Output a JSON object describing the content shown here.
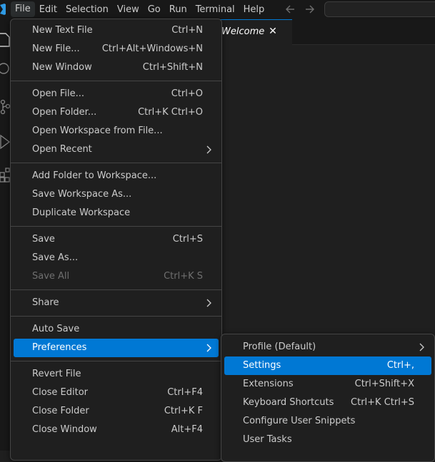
{
  "menubar": {
    "items": [
      "File",
      "Edit",
      "Selection",
      "View",
      "Go",
      "Run",
      "Terminal",
      "Help"
    ]
  },
  "nav": {
    "back_icon": "arrow-left-icon",
    "forward_icon": "arrow-right-icon"
  },
  "editor": {
    "tab": {
      "label": "Welcome",
      "close": "✕"
    }
  },
  "file_menu": {
    "groups": [
      [
        {
          "label": "New Text File",
          "shortcut": "Ctrl+N"
        },
        {
          "label": "New File...",
          "shortcut": "Ctrl+Alt+Windows+N"
        },
        {
          "label": "New Window",
          "shortcut": "Ctrl+Shift+N"
        }
      ],
      [
        {
          "label": "Open File...",
          "shortcut": "Ctrl+O"
        },
        {
          "label": "Open Folder...",
          "shortcut": "Ctrl+K Ctrl+O"
        },
        {
          "label": "Open Workspace from File...",
          "shortcut": ""
        },
        {
          "label": "Open Recent",
          "shortcut": "",
          "submenu": true
        }
      ],
      [
        {
          "label": "Add Folder to Workspace...",
          "shortcut": ""
        },
        {
          "label": "Save Workspace As...",
          "shortcut": ""
        },
        {
          "label": "Duplicate Workspace",
          "shortcut": ""
        }
      ],
      [
        {
          "label": "Save",
          "shortcut": "Ctrl+S"
        },
        {
          "label": "Save As...",
          "shortcut": ""
        },
        {
          "label": "Save All",
          "shortcut": "Ctrl+K S",
          "disabled": true
        }
      ],
      [
        {
          "label": "Share",
          "shortcut": "",
          "submenu": true
        }
      ],
      [
        {
          "label": "Auto Save",
          "shortcut": ""
        },
        {
          "label": "Preferences",
          "shortcut": "",
          "submenu": true,
          "highlight": true
        }
      ],
      [
        {
          "label": "Revert File",
          "shortcut": ""
        },
        {
          "label": "Close Editor",
          "shortcut": "Ctrl+F4"
        },
        {
          "label": "Close Folder",
          "shortcut": "Ctrl+K F"
        },
        {
          "label": "Close Window",
          "shortcut": "Alt+F4"
        }
      ]
    ]
  },
  "preferences_menu": {
    "items": [
      {
        "label": "Profile (Default)",
        "shortcut": "",
        "submenu": true
      },
      {
        "label": "Settings",
        "shortcut": "Ctrl+,",
        "highlight": true
      },
      {
        "label": "Extensions",
        "shortcut": "Ctrl+Shift+X"
      },
      {
        "label": "Keyboard Shortcuts",
        "shortcut": "Ctrl+K Ctrl+S"
      },
      {
        "label": "Configure User Snippets",
        "shortcut": ""
      },
      {
        "label": "User Tasks",
        "shortcut": ""
      }
    ]
  },
  "colors": {
    "accent": "#0078d4",
    "menu_bg": "#1f1f1f",
    "border": "#454545"
  }
}
